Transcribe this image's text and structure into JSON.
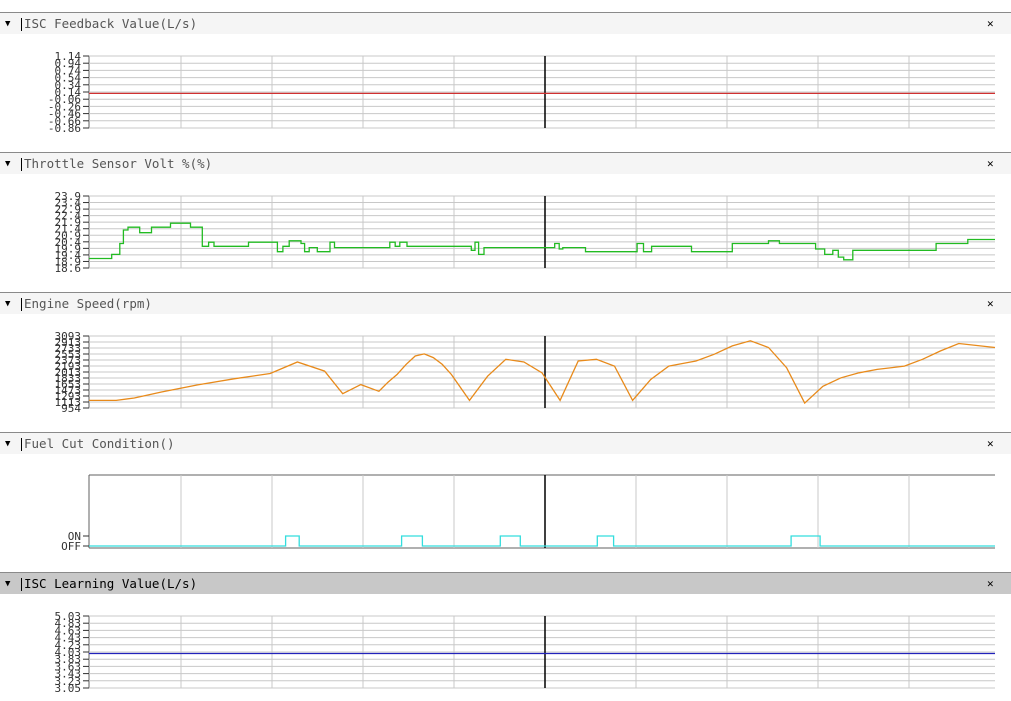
{
  "panels": [
    {
      "title": "ISC Feedback Value(L/s)",
      "selected": false,
      "line_color": "#d03030",
      "y_ticks": [
        "1.14",
        "0.94",
        "0.74",
        "0.54",
        "0.34",
        "0.14",
        "-0.06",
        "-0.26",
        "-0.46",
        "-0.66",
        "-0.86"
      ],
      "chart_data": {
        "type": "line",
        "ylim": [
          -0.86,
          1.14
        ],
        "x": [
          0,
          100
        ],
        "y": [
          0.1,
          0.1
        ]
      }
    },
    {
      "title": "Throttle Sensor Volt %(%)",
      "selected": false,
      "line_color": "#22bb22",
      "y_ticks": [
        "23.9",
        "23.4",
        "22.9",
        "22.4",
        "21.9",
        "21.4",
        "20.9",
        "20.4",
        "19.9",
        "19.4",
        "18.9",
        "18.6"
      ],
      "chart_data": {
        "type": "line",
        "ylim": [
          18.6,
          23.9
        ],
        "x": [
          0,
          2.5,
          2.5,
          3.4,
          3.4,
          3.8,
          3.8,
          4.3,
          4.3,
          5.6,
          5.6,
          6.9,
          6.9,
          9,
          9,
          11.2,
          11.2,
          12.5,
          12.5,
          13.2,
          13.2,
          13.8,
          13.8,
          17.6,
          17.6,
          20.8,
          20.8,
          21.4,
          21.4,
          22.1,
          22.1,
          23.4,
          23.4,
          23.8,
          23.8,
          24.3,
          24.3,
          25.2,
          25.2,
          26.6,
          26.6,
          27.1,
          27.1,
          33.2,
          33.2,
          33.8,
          33.8,
          34.3,
          34.3,
          35.1,
          35.1,
          42.2,
          42.2,
          42.6,
          42.6,
          43,
          43,
          43.6,
          43.6,
          51.4,
          51.4,
          51.9,
          51.9,
          52.3,
          52.3,
          54.8,
          54.8,
          60.5,
          60.5,
          61.2,
          61.2,
          62.1,
          62.1,
          66.5,
          66.5,
          71,
          71,
          75,
          75,
          76.2,
          76.2,
          80.2,
          80.2,
          81.2,
          81.2,
          82.1,
          82.1,
          82.7,
          82.7,
          83.3,
          83.3,
          84.3,
          84.3,
          93.5,
          93.5,
          97,
          97,
          100
        ],
        "y": [
          19.3,
          19.3,
          19.6,
          19.6,
          20.4,
          20.4,
          21.4,
          21.4,
          21.6,
          21.6,
          21.2,
          21.2,
          21.6,
          21.6,
          21.9,
          21.9,
          21.6,
          21.6,
          20.2,
          20.2,
          20.5,
          20.5,
          20.2,
          20.2,
          20.5,
          20.5,
          19.8,
          19.8,
          20.2,
          20.2,
          20.6,
          20.6,
          20.4,
          20.4,
          19.8,
          19.8,
          20.1,
          20.1,
          19.8,
          19.8,
          20.5,
          20.5,
          20.1,
          20.1,
          20.5,
          20.5,
          20.2,
          20.2,
          20.5,
          20.5,
          20.2,
          20.2,
          19.9,
          19.9,
          20.5,
          20.5,
          19.6,
          19.6,
          20.1,
          20.1,
          20.4,
          20.4,
          20.0,
          20.0,
          20.1,
          20.1,
          19.8,
          19.8,
          20.4,
          20.4,
          19.8,
          19.8,
          20.2,
          20.2,
          19.8,
          19.8,
          20.4,
          20.4,
          20.6,
          20.6,
          20.4,
          20.4,
          20.0,
          20.0,
          19.6,
          19.6,
          19.9,
          19.9,
          19.4,
          19.4,
          19.2,
          19.2,
          19.9,
          19.9,
          20.4,
          20.4,
          20.7,
          20.7
        ]
      }
    },
    {
      "title": "Engine Speed(rpm)",
      "selected": false,
      "line_color": "#e88a1a",
      "y_ticks": [
        "3093",
        "2913",
        "2733",
        "2553",
        "2373",
        "2193",
        "2013",
        "1833",
        "1653",
        "1473",
        "1293",
        "1113",
        "954"
      ],
      "chart_data": {
        "type": "line",
        "ylim": [
          954,
          3093
        ],
        "x": [
          0,
          3,
          5,
          8,
          12,
          16,
          20,
          23,
          26,
          28,
          30,
          32,
          33,
          34,
          35,
          36,
          37,
          38,
          39,
          40,
          42,
          44,
          46,
          48,
          50,
          52,
          54,
          56,
          58,
          60,
          62,
          64,
          65,
          67,
          69,
          71,
          73,
          75,
          77,
          79,
          81,
          83,
          85,
          87,
          90,
          92,
          94,
          96,
          100
        ],
        "y": [
          1180,
          1180,
          1250,
          1430,
          1640,
          1820,
          1980,
          2320,
          2050,
          1380,
          1650,
          1450,
          1720,
          1950,
          2250,
          2500,
          2560,
          2450,
          2250,
          1950,
          1180,
          1900,
          2400,
          2320,
          2000,
          1180,
          2350,
          2400,
          2200,
          1180,
          1800,
          2200,
          2250,
          2350,
          2550,
          2800,
          2950,
          2750,
          2150,
          1100,
          1600,
          1850,
          2000,
          2100,
          2200,
          2400,
          2650,
          2870,
          2750
        ]
      }
    },
    {
      "title": "Fuel Cut Condition()",
      "selected": false,
      "line_color": "#33dddd",
      "y_ticks": [
        "ON",
        "OFF"
      ],
      "chart_data": {
        "type": "line",
        "ylim": [
          0,
          1
        ],
        "x": [
          0,
          21.7,
          21.7,
          23.2,
          23.2,
          34.5,
          34.5,
          36.8,
          36.8,
          45.4,
          45.4,
          47.6,
          47.6,
          56.1,
          56.1,
          57.9,
          57.9,
          77.5,
          77.5,
          80.7,
          80.7,
          100
        ],
        "y": [
          0,
          0,
          1,
          1,
          0,
          0,
          1,
          1,
          0,
          0,
          1,
          1,
          0,
          0,
          1,
          1,
          0,
          0,
          1,
          1,
          0,
          0
        ]
      }
    },
    {
      "title": "ISC Learning Value(L/s)",
      "selected": true,
      "line_color": "#2222bb",
      "y_ticks": [
        "5.03",
        "4.83",
        "4.63",
        "4.43",
        "4.23",
        "4.03",
        "3.83",
        "3.63",
        "3.43",
        "3.23",
        "3.05"
      ],
      "chart_data": {
        "type": "line",
        "ylim": [
          3.05,
          5.03
        ],
        "x": [
          0,
          100
        ],
        "y": [
          4.0,
          4.0
        ]
      }
    }
  ]
}
